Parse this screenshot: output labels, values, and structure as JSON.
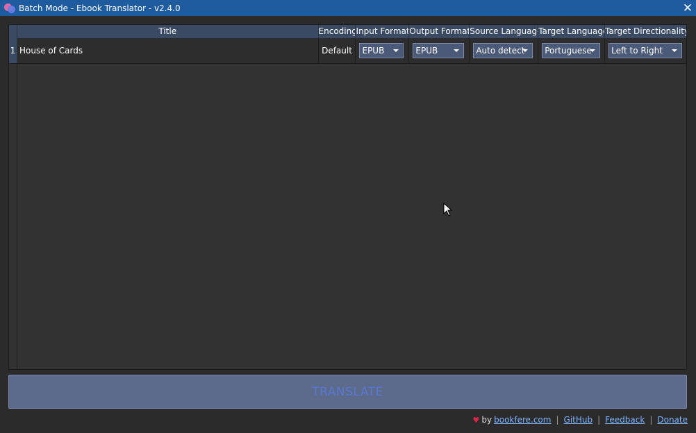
{
  "window": {
    "title": "Batch Mode - Ebook Translator - v2.4.0",
    "close_symbol": "✕"
  },
  "table": {
    "columns": [
      "Title",
      "Encoding",
      "Input Format",
      "Output Format",
      "Source Language",
      "Target Language",
      "Target Directionality"
    ],
    "rows": [
      {
        "index": "1",
        "title": "House of Cards",
        "encoding": "Default",
        "input_format": "EPUB",
        "output_format": "EPUB",
        "source_language": "Auto detect",
        "target_language": "Portuguese",
        "target_directionality": "Left to Right"
      }
    ]
  },
  "translate_button": {
    "label": "TRANSLATE"
  },
  "footer": {
    "heart": "♥",
    "by": "by",
    "links": [
      "bookfere.com",
      "GitHub",
      "Feedback",
      "Donate"
    ],
    "separator": "|"
  },
  "colors": {
    "titlebar": "#1e5c9f",
    "background": "#2b2b2b",
    "header": "#3a4a63",
    "dropdown": "#4c5a7a",
    "button": "#5c6a8c",
    "button_text": "#5a78d0",
    "link": "#7fb3ff",
    "heart": "#e0244a"
  }
}
